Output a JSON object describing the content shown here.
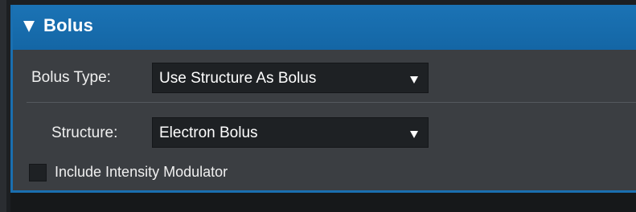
{
  "panel": {
    "title": "Bolus",
    "expanded": true,
    "accent_color": "#1a6fb0"
  },
  "bolus_type": {
    "label": "Bolus Type:",
    "value": "Use Structure As Bolus"
  },
  "structure": {
    "label": "Structure:",
    "value": "Electron Bolus"
  },
  "intensity_modulator": {
    "label": "Include Intensity Modulator",
    "checked": false
  }
}
